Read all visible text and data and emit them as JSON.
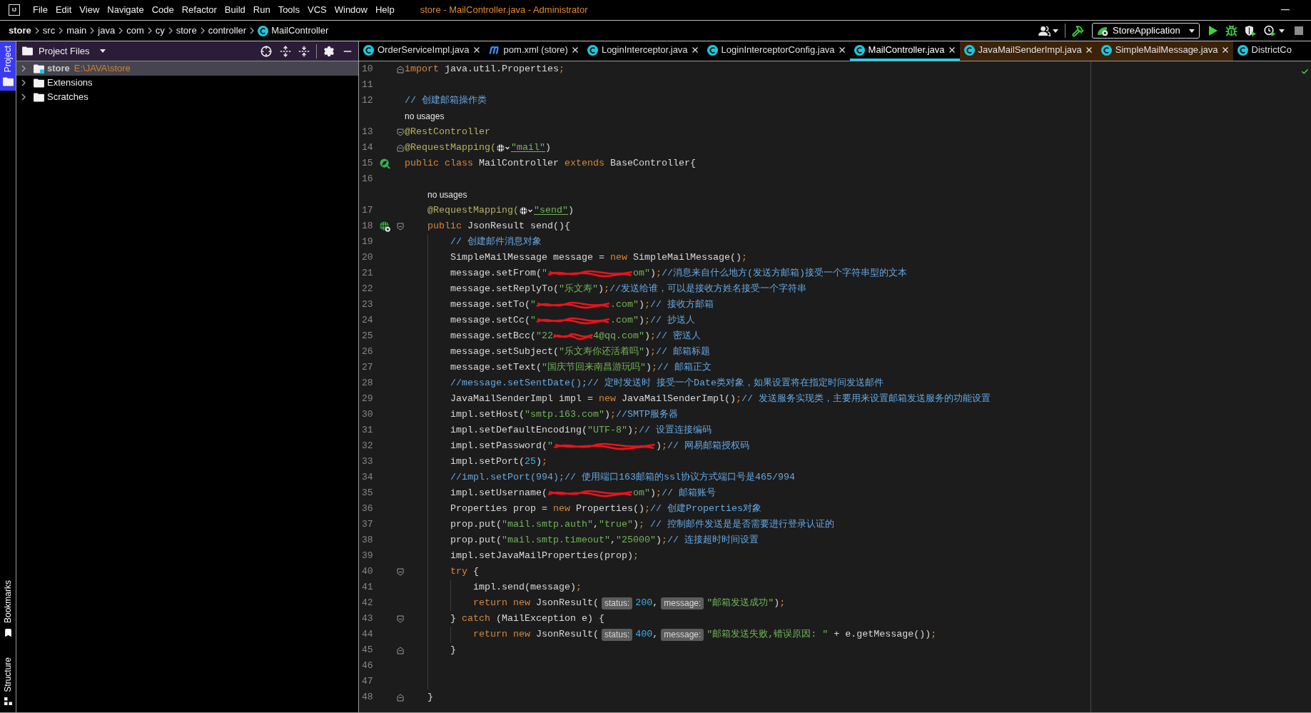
{
  "window": {
    "logo": "IJ",
    "title": "store - MailController.java - Administrator",
    "menu": [
      {
        "label": "File"
      },
      {
        "label": "Edit"
      },
      {
        "label": "View"
      },
      {
        "label": "Navigate"
      },
      {
        "label": "Code"
      },
      {
        "label": "Refactor"
      },
      {
        "label": "Build"
      },
      {
        "label": "Run"
      },
      {
        "label": "Tools"
      },
      {
        "label": "VCS"
      },
      {
        "label": "Window"
      },
      {
        "label": "Help"
      }
    ]
  },
  "navigation": {
    "breadcrumbs": [
      {
        "label": "store",
        "kind": "project"
      },
      {
        "label": "src",
        "kind": "package"
      },
      {
        "label": "main",
        "kind": "package"
      },
      {
        "label": "java",
        "kind": "package"
      },
      {
        "label": "com",
        "kind": "package"
      },
      {
        "label": "cy",
        "kind": "package"
      },
      {
        "label": "store",
        "kind": "package"
      },
      {
        "label": "controller",
        "kind": "package"
      },
      {
        "label": "MailController",
        "kind": "class"
      }
    ],
    "run_configuration": "StoreApplication"
  },
  "tool_windows": {
    "top": [
      {
        "label": "Project",
        "kind": "project",
        "selected": true
      }
    ],
    "bottom": [
      {
        "label": "Bookmarks",
        "kind": "bookmarks",
        "selected": false
      },
      {
        "label": "Structure",
        "kind": "structure",
        "selected": false
      }
    ]
  },
  "project_panel": {
    "title": "Project Files",
    "tree": [
      {
        "name": "store",
        "path": "E:\\JAVA\\store",
        "kind": "module",
        "expanded": false,
        "selected": true
      },
      {
        "name": "Extensions",
        "kind": "folder",
        "expanded": false,
        "selected": false
      },
      {
        "name": "Scratches",
        "kind": "folder",
        "expanded": false,
        "selected": false
      }
    ]
  },
  "tabs": [
    {
      "label": "OrderServiceImpl.java",
      "kind": "class",
      "selected": false,
      "library": false,
      "closable": true
    },
    {
      "label": "pom.xml (store)",
      "kind": "maven",
      "selected": false,
      "library": false,
      "closable": true
    },
    {
      "label": "LoginInterceptor.java",
      "kind": "class",
      "selected": false,
      "library": false,
      "closable": true
    },
    {
      "label": "LoginInterceptorConfig.java",
      "kind": "class",
      "selected": false,
      "library": false,
      "closable": true
    },
    {
      "label": "MailController.java",
      "kind": "class",
      "selected": true,
      "library": false,
      "closable": true
    },
    {
      "label": "JavaMailSenderImpl.java",
      "kind": "class",
      "selected": false,
      "library": true,
      "closable": true
    },
    {
      "label": "SimpleMailMessage.java",
      "kind": "class",
      "selected": false,
      "library": true,
      "closable": true
    },
    {
      "label": "DistrictCo",
      "kind": "class",
      "selected": false,
      "library": false,
      "closable": false
    }
  ],
  "editor": {
    "lines": [
      {
        "kind": "code",
        "number": "10",
        "fold": {
          "kind": "end"
        },
        "tokens": [
          {
            "kind": "keyword",
            "text": "import"
          },
          {
            "kind": "plain",
            "text": " java.util.Properties"
          },
          {
            "kind": "punct",
            "text": ";"
          }
        ]
      },
      {
        "kind": "code",
        "number": "11"
      },
      {
        "kind": "code",
        "number": "12",
        "tokens": [
          {
            "kind": "comment",
            "text": "// 创建邮箱操作类"
          }
        ]
      },
      {
        "kind": "usages",
        "text": "no usages"
      },
      {
        "kind": "code",
        "number": "13",
        "fold": {
          "kind": "start"
        },
        "tokens": [
          {
            "kind": "annotation",
            "text": "@RestController"
          }
        ]
      },
      {
        "kind": "code",
        "number": "14",
        "fold": {
          "kind": "end"
        },
        "tokens": [
          {
            "kind": "annotation",
            "text": "@RequestMapping("
          },
          {
            "kind": "globe"
          },
          {
            "kind": "link",
            "text": "\"mail\""
          },
          {
            "kind": "plain",
            "text": ")"
          }
        ]
      },
      {
        "kind": "code",
        "number": "15",
        "gutter": {
          "kind": "bean"
        },
        "tokens": [
          {
            "kind": "keyword",
            "text": "public class"
          },
          {
            "kind": "plain",
            "text": " MailController "
          },
          {
            "kind": "keyword",
            "text": "extends"
          },
          {
            "kind": "plain",
            "text": " BaseController{"
          }
        ],
        "children": [
          {
            "kind": "code",
            "number": "16"
          },
          {
            "kind": "usages",
            "text": "no usages"
          },
          {
            "kind": "code",
            "number": "17",
            "tokens": [
              {
                "kind": "annotation",
                "text": "@RequestMapping("
              },
              {
                "kind": "globe"
              },
              {
                "kind": "link",
                "text": "\"send\""
              },
              {
                "kind": "plain",
                "text": ")"
              }
            ]
          },
          {
            "kind": "code",
            "number": "18",
            "gutter": {
              "kind": "endpoint"
            },
            "fold": {
              "kind": "start"
            },
            "tokens": [
              {
                "kind": "keyword",
                "text": "public"
              },
              {
                "kind": "plain",
                "text": " JsonResult send(){"
              }
            ],
            "children": [
              {
                "kind": "code",
                "number": "19",
                "tokens": [
                  {
                    "kind": "comment",
                    "text": "// 创建邮件消息对象"
                  }
                ]
              },
              {
                "kind": "code",
                "number": "20",
                "tokens": [
                  {
                    "kind": "plain",
                    "text": "SimpleMailMessage message = "
                  },
                  {
                    "kind": "keyword",
                    "text": "new"
                  },
                  {
                    "kind": "plain",
                    "text": " SimpleMailMessage()"
                  },
                  {
                    "kind": "punct",
                    "text": ";"
                  }
                ]
              },
              {
                "kind": "code",
                "number": "21",
                "tokens": [
                  {
                    "kind": "plain",
                    "text": "message.setFrom("
                  },
                  {
                    "kind": "string",
                    "text": "\""
                  },
                  {
                    "kind": "scribble"
                  },
                  {
                    "kind": "string",
                    "text": "om\""
                  },
                  {
                    "kind": "plain",
                    "text": ")"
                  },
                  {
                    "kind": "punct",
                    "text": ";"
                  },
                  {
                    "kind": "comment",
                    "text": "//消息来自什么地方(发送方邮箱)接受一个字符串型的文本"
                  }
                ]
              },
              {
                "kind": "code",
                "number": "22",
                "tokens": [
                  {
                    "kind": "plain",
                    "text": "message.setReplyTo("
                  },
                  {
                    "kind": "string",
                    "text": "\"乐文寿\""
                  },
                  {
                    "kind": "plain",
                    "text": ")"
                  },
                  {
                    "kind": "punct",
                    "text": ";"
                  },
                  {
                    "kind": "comment",
                    "text": "//发送给谁，可以是接收方姓名接受一个字符串"
                  }
                ]
              },
              {
                "kind": "code",
                "number": "23",
                "tokens": [
                  {
                    "kind": "plain",
                    "text": "message.setTo("
                  },
                  {
                    "kind": "string",
                    "text": "\""
                  },
                  {
                    "kind": "scribble"
                  },
                  {
                    "kind": "string",
                    "text": ".com\""
                  },
                  {
                    "kind": "plain",
                    "text": ")"
                  },
                  {
                    "kind": "punct",
                    "text": ";"
                  },
                  {
                    "kind": "comment",
                    "text": "// 接收方邮箱"
                  }
                ]
              },
              {
                "kind": "code",
                "number": "24",
                "tokens": [
                  {
                    "kind": "plain",
                    "text": "message.setCc("
                  },
                  {
                    "kind": "string",
                    "text": "\""
                  },
                  {
                    "kind": "scribble"
                  },
                  {
                    "kind": "string",
                    "text": ".com\""
                  },
                  {
                    "kind": "plain",
                    "text": ")"
                  },
                  {
                    "kind": "punct",
                    "text": ";"
                  },
                  {
                    "kind": "comment",
                    "text": "// 抄送人"
                  }
                ]
              },
              {
                "kind": "code",
                "number": "25",
                "tokens": [
                  {
                    "kind": "plain",
                    "text": "message.setBcc("
                  },
                  {
                    "kind": "string",
                    "text": "\"22"
                  },
                  {
                    "kind": "scribble"
                  },
                  {
                    "kind": "string",
                    "text": "4@qq.com\""
                  },
                  {
                    "kind": "plain",
                    "text": ")"
                  },
                  {
                    "kind": "punct",
                    "text": ";"
                  },
                  {
                    "kind": "comment",
                    "text": "// 密送人"
                  }
                ]
              },
              {
                "kind": "code",
                "number": "26",
                "tokens": [
                  {
                    "kind": "plain",
                    "text": "message.setSubject("
                  },
                  {
                    "kind": "string",
                    "text": "\"乐文寿你还活着吗\""
                  },
                  {
                    "kind": "plain",
                    "text": ")"
                  },
                  {
                    "kind": "punct",
                    "text": ";"
                  },
                  {
                    "kind": "comment",
                    "text": "// 邮箱标题"
                  }
                ]
              },
              {
                "kind": "code",
                "number": "27",
                "tokens": [
                  {
                    "kind": "plain",
                    "text": "message.setText("
                  },
                  {
                    "kind": "string",
                    "text": "\"国庆节回来南昌游玩吗\""
                  },
                  {
                    "kind": "plain",
                    "text": ")"
                  },
                  {
                    "kind": "punct",
                    "text": ";"
                  },
                  {
                    "kind": "comment",
                    "text": "// 邮箱正文"
                  }
                ]
              },
              {
                "kind": "code",
                "number": "28",
                "tokens": [
                  {
                    "kind": "comment",
                    "text": "//message.setSentDate();// 定时发送时 接受一个Date类对象，如果设置将在指定时间发送邮件"
                  }
                ]
              },
              {
                "kind": "code",
                "number": "29",
                "tokens": [
                  {
                    "kind": "plain",
                    "text": "JavaMailSenderImpl impl = "
                  },
                  {
                    "kind": "keyword",
                    "text": "new"
                  },
                  {
                    "kind": "plain",
                    "text": " JavaMailSenderImpl()"
                  },
                  {
                    "kind": "punct",
                    "text": ";"
                  },
                  {
                    "kind": "comment",
                    "text": "// 发送服务实现类，主要用来设置邮箱发送服务的功能设置"
                  }
                ]
              },
              {
                "kind": "code",
                "number": "30",
                "tokens": [
                  {
                    "kind": "plain",
                    "text": "impl.setHost("
                  },
                  {
                    "kind": "string",
                    "text": "\"smtp.163.com\""
                  },
                  {
                    "kind": "plain",
                    "text": ")"
                  },
                  {
                    "kind": "punct",
                    "text": ";"
                  },
                  {
                    "kind": "comment",
                    "text": "//SMTP服务器"
                  }
                ]
              },
              {
                "kind": "code",
                "number": "31",
                "tokens": [
                  {
                    "kind": "plain",
                    "text": "impl.setDefaultEncoding("
                  },
                  {
                    "kind": "string",
                    "text": "\"UTF-8\""
                  },
                  {
                    "kind": "plain",
                    "text": ")"
                  },
                  {
                    "kind": "punct",
                    "text": ";"
                  },
                  {
                    "kind": "comment",
                    "text": "// 设置连接编码"
                  }
                ]
              },
              {
                "kind": "code",
                "number": "32",
                "tokens": [
                  {
                    "kind": "plain",
                    "text": "impl.setPassword("
                  },
                  {
                    "kind": "string",
                    "text": "\""
                  },
                  {
                    "kind": "scribble"
                  },
                  {
                    "kind": "plain",
                    "text": ")"
                  },
                  {
                    "kind": "punct",
                    "text": ";"
                  },
                  {
                    "kind": "comment",
                    "text": "// 网易邮箱授权码"
                  }
                ]
              },
              {
                "kind": "code",
                "number": "33",
                "tokens": [
                  {
                    "kind": "plain",
                    "text": "impl.setPort("
                  },
                  {
                    "kind": "number",
                    "text": "25"
                  },
                  {
                    "kind": "plain",
                    "text": ")"
                  },
                  {
                    "kind": "punct",
                    "text": ";"
                  }
                ]
              },
              {
                "kind": "code",
                "number": "34",
                "tokens": [
                  {
                    "kind": "comment",
                    "text": "//impl.setPort(994);// 使用端口163邮箱的ssl协议方式端口号是465/994"
                  }
                ]
              },
              {
                "kind": "code",
                "number": "35",
                "tokens": [
                  {
                    "kind": "plain",
                    "text": "impl.setUsername("
                  },
                  {
                    "kind": "scribble"
                  },
                  {
                    "kind": "string",
                    "text": "om\""
                  },
                  {
                    "kind": "plain",
                    "text": ")"
                  },
                  {
                    "kind": "punct",
                    "text": ";"
                  },
                  {
                    "kind": "comment",
                    "text": "// 邮箱账号"
                  }
                ]
              },
              {
                "kind": "code",
                "number": "36",
                "tokens": [
                  {
                    "kind": "plain",
                    "text": "Properties prop = "
                  },
                  {
                    "kind": "keyword",
                    "text": "new"
                  },
                  {
                    "kind": "plain",
                    "text": " Properties()"
                  },
                  {
                    "kind": "punct",
                    "text": ";"
                  },
                  {
                    "kind": "comment",
                    "text": "// 创建Properties对象"
                  }
                ]
              },
              {
                "kind": "code",
                "number": "37",
                "tokens": [
                  {
                    "kind": "plain",
                    "text": "prop.put("
                  },
                  {
                    "kind": "string",
                    "text": "\"mail.smtp.auth\""
                  },
                  {
                    "kind": "plain",
                    "text": ","
                  },
                  {
                    "kind": "string",
                    "text": "\"true\""
                  },
                  {
                    "kind": "plain",
                    "text": ")"
                  },
                  {
                    "kind": "punct",
                    "text": ";"
                  },
                  {
                    "kind": "comment",
                    "text": " // 控制邮件发送是是否需要进行登录认证的"
                  }
                ]
              },
              {
                "kind": "code",
                "number": "38",
                "tokens": [
                  {
                    "kind": "plain",
                    "text": "prop.put("
                  },
                  {
                    "kind": "string",
                    "text": "\"mail.smtp.timeout\""
                  },
                  {
                    "kind": "plain",
                    "text": ","
                  },
                  {
                    "kind": "string",
                    "text": "\"25000\""
                  },
                  {
                    "kind": "plain",
                    "text": ")"
                  },
                  {
                    "kind": "punct",
                    "text": ";"
                  },
                  {
                    "kind": "comment",
                    "text": "// 连接超时时间设置"
                  }
                ]
              },
              {
                "kind": "code",
                "number": "39",
                "tokens": [
                  {
                    "kind": "plain",
                    "text": "impl.setJavaMailProperties(prop)"
                  },
                  {
                    "kind": "punct",
                    "text": ";"
                  }
                ]
              },
              {
                "kind": "code",
                "number": "40",
                "fold": {
                  "kind": "start"
                },
                "tokens": [
                  {
                    "kind": "keyword",
                    "text": "try"
                  },
                  {
                    "kind": "plain",
                    "text": " {"
                  }
                ],
                "children": [
                  {
                    "kind": "code",
                    "number": "41",
                    "tokens": [
                      {
                        "kind": "plain",
                        "text": "impl.send(message)"
                      },
                      {
                        "kind": "punct",
                        "text": ";"
                      }
                    ]
                  },
                  {
                    "kind": "code",
                    "number": "42",
                    "tokens": [
                      {
                        "kind": "keyword",
                        "text": "return new"
                      },
                      {
                        "kind": "plain",
                        "text": " JsonResult("
                      },
                      {
                        "kind": "hint",
                        "text": "status:"
                      },
                      {
                        "kind": "number",
                        "text": "200"
                      },
                      {
                        "kind": "plain",
                        "text": ","
                      },
                      {
                        "kind": "hint",
                        "text": "message:"
                      },
                      {
                        "kind": "string",
                        "text": "\"邮箱发送成功\""
                      },
                      {
                        "kind": "plain",
                        "text": ")"
                      },
                      {
                        "kind": "punct",
                        "text": ";"
                      }
                    ]
                  }
                ]
              },
              {
                "kind": "code",
                "number": "43",
                "fold": {
                  "kind": "start"
                },
                "tokens": [
                  {
                    "kind": "plain",
                    "text": "} "
                  },
                  {
                    "kind": "keyword",
                    "text": "catch"
                  },
                  {
                    "kind": "plain",
                    "text": " (MailException e) {"
                  }
                ],
                "children": [
                  {
                    "kind": "code",
                    "number": "44",
                    "tokens": [
                      {
                        "kind": "keyword",
                        "text": "return new"
                      },
                      {
                        "kind": "plain",
                        "text": " JsonResult("
                      },
                      {
                        "kind": "hint",
                        "text": "status:"
                      },
                      {
                        "kind": "number",
                        "text": "400"
                      },
                      {
                        "kind": "plain",
                        "text": ","
                      },
                      {
                        "kind": "hint",
                        "text": "message:"
                      },
                      {
                        "kind": "string",
                        "text": "\"邮箱发送失败,错误原因: \""
                      },
                      {
                        "kind": "plain",
                        "text": " + e.getMessage())"
                      },
                      {
                        "kind": "punct",
                        "text": ";"
                      }
                    ]
                  }
                ]
              },
              {
                "kind": "code",
                "number": "45",
                "fold": {
                  "kind": "end"
                },
                "tokens": [
                  {
                    "kind": "plain",
                    "text": "}"
                  }
                ]
              },
              {
                "kind": "code",
                "number": "46"
              },
              {
                "kind": "code",
                "number": "47"
              }
            ]
          },
          {
            "kind": "code",
            "number": "48",
            "fold": {
              "kind": "end"
            },
            "tokens": [
              {
                "kind": "plain",
                "text": "}"
              }
            ]
          }
        ]
      }
    ]
  }
}
